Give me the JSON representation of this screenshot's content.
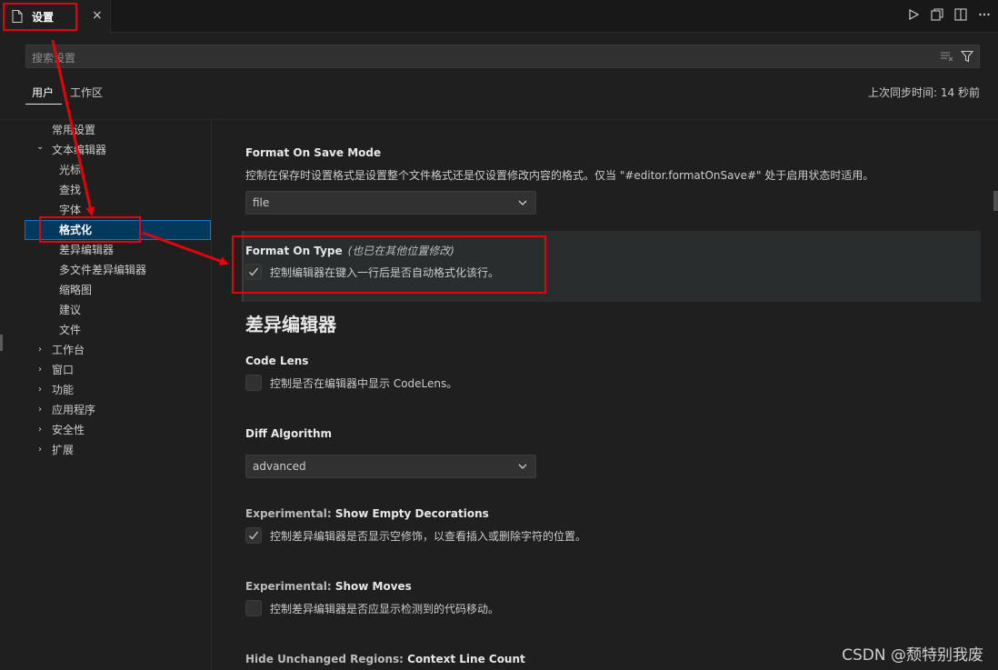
{
  "tab": {
    "title": "设置",
    "close": "×"
  },
  "search": {
    "placeholder": "搜索设置"
  },
  "scope": {
    "user": "用户",
    "workspace": "工作区",
    "sync_status": "上次同步时间: 14 秒前"
  },
  "toc": {
    "items": [
      {
        "label": "常用设置",
        "chevron": ""
      },
      {
        "label": "文本编辑器",
        "chevron": "⌄"
      },
      {
        "label": "光标",
        "chevron": ""
      },
      {
        "label": "查找",
        "chevron": ""
      },
      {
        "label": "字体",
        "chevron": ""
      },
      {
        "label": "格式化",
        "chevron": ""
      },
      {
        "label": "差异编辑器",
        "chevron": ""
      },
      {
        "label": "多文件差异编辑器",
        "chevron": ""
      },
      {
        "label": "缩略图",
        "chevron": ""
      },
      {
        "label": "建议",
        "chevron": ""
      },
      {
        "label": "文件",
        "chevron": ""
      },
      {
        "label": "工作台",
        "chevron": "›"
      },
      {
        "label": "窗口",
        "chevron": "›"
      },
      {
        "label": "功能",
        "chevron": "›"
      },
      {
        "label": "应用程序",
        "chevron": "›"
      },
      {
        "label": "安全性",
        "chevron": "›"
      },
      {
        "label": "扩展",
        "chevron": "›"
      }
    ]
  },
  "settings": {
    "format_on_save_mode": {
      "title": "Format On Save Mode",
      "description": "控制在保存时设置格式是设置整个文件格式还是仅设置修改内容的格式。仅当 \"#editor.formatOnSave#\" 处于启用状态时适用。",
      "value": "file"
    },
    "format_on_type": {
      "title": "Format On Type",
      "modified_note": "(也已在其他位置修改)",
      "description": "控制编辑器在键入一行后是否自动格式化该行。",
      "checked": true
    },
    "diff_section_heading": "差异编辑器",
    "code_lens": {
      "title": "Code Lens",
      "description": "控制是否在编辑器中显示 CodeLens。",
      "checked": false
    },
    "diff_algorithm": {
      "title": "Diff Algorithm",
      "value": "advanced"
    },
    "show_empty_decorations": {
      "category": "Experimental: ",
      "title": "Show Empty Decorations",
      "description": "控制差异编辑器是否显示空修饰，以查看插入或删除字符的位置。",
      "checked": true
    },
    "show_moves": {
      "category": "Experimental: ",
      "title": "Show Moves",
      "description": "控制差异编辑器是否应显示检测到的代码移动。",
      "checked": false
    },
    "hide_unchanged": {
      "category": "Hide Unchanged Regions: ",
      "title": "Context Line Count"
    }
  },
  "watermark": "CSDN @颓特别我废",
  "colors": {
    "background": "#1f1f1f",
    "accent_focus": "#0078d4",
    "annotation_red": "#e5000b"
  }
}
